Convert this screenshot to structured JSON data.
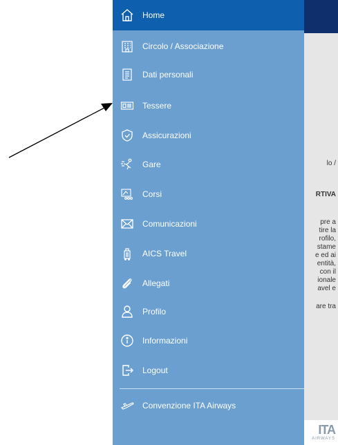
{
  "menu": {
    "items": [
      {
        "label": "Home",
        "icon": "home-icon",
        "active": true
      },
      {
        "label": "Circolo / Associazione",
        "icon": "building-icon"
      },
      {
        "label": "Dati personali",
        "icon": "document-icon"
      },
      {
        "label": "Tessere",
        "icon": "card-icon"
      },
      {
        "label": "Assicurazioni",
        "icon": "shield-icon"
      },
      {
        "label": "Gare",
        "icon": "runner-icon"
      },
      {
        "label": "Corsi",
        "icon": "course-icon"
      },
      {
        "label": "Comunicazioni",
        "icon": "mail-icon"
      },
      {
        "label": "AICS Travel",
        "icon": "luggage-icon"
      },
      {
        "label": "Allegati",
        "icon": "paperclip-icon"
      },
      {
        "label": "Profilo",
        "icon": "person-icon"
      },
      {
        "label": "Informazioni",
        "icon": "info-icon"
      },
      {
        "label": "Logout",
        "icon": "logout-icon"
      },
      {
        "label": "Convenzione ITA Airways",
        "icon": "plane-icon"
      }
    ]
  },
  "background": {
    "lines": [
      "lo /",
      "RTIVA",
      "pre a",
      "tire la",
      "rofilo,",
      "stame",
      "e ed ai",
      "entità,",
      "con il",
      "ionale",
      "avel e",
      "are tra"
    ],
    "logo": "ITA",
    "logo_sub": "AIRWAYS"
  },
  "colors": {
    "drawer": "#6a9fd0",
    "active": "#0e5fae",
    "header": "#0e2f6b"
  }
}
